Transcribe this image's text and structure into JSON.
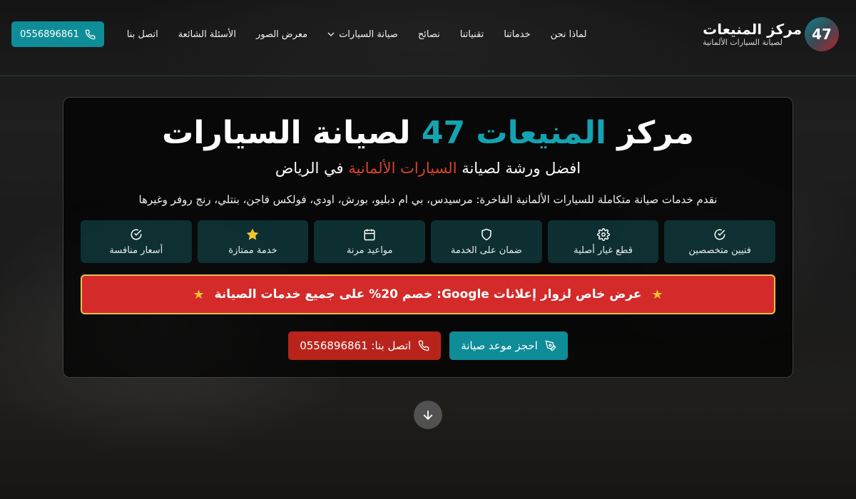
{
  "header": {
    "logo_text": "47",
    "brand_title": "مركز المنيعات",
    "brand_subtitle": "لصيانة السيارات الألمانية",
    "nav": [
      {
        "label": "لماذا نحن"
      },
      {
        "label": "خدماتنا"
      },
      {
        "label": "تقنياتنا"
      },
      {
        "label": "نصائح"
      },
      {
        "label": "صيانة السيارات",
        "has_dropdown": true
      },
      {
        "label": "معرض الصور"
      },
      {
        "label": "الأسئلة الشائعة"
      },
      {
        "label": "اتصل بنا"
      }
    ],
    "phone_button": "0556896861"
  },
  "hero": {
    "title_part1": "مركز ",
    "title_part2": "المنيعات 47",
    "title_part3": " لصيانة السيارات",
    "subtitle_part1": "افضل ورشة لصيانة ",
    "subtitle_part2": "السيارات الألمانية",
    "subtitle_part3": " في الرياض",
    "description": "نقدم خدمات صيانة متكاملة للسيارات الألمانية الفاخرة: مرسيدس، بي ام دبليو، بورش، اودي، فولكس فاجن، بنتلي، رنج روفر وغيرها",
    "features": [
      {
        "label": "فنيين متخصصين",
        "icon": "check-circle-icon"
      },
      {
        "label": "قطع غيار أصلية",
        "icon": "gear-icon"
      },
      {
        "label": "ضمان على الخدمة",
        "icon": "shield-icon"
      },
      {
        "label": "مواعيد مرنة",
        "icon": "calendar-icon"
      },
      {
        "label": "خدمة ممتازة",
        "icon": "star-icon"
      },
      {
        "label": "أسعار منافسة",
        "icon": "check-circle-icon"
      }
    ],
    "offer_text": "عرض خاص لزوار إعلانات Google: خصم 20% على جميع خدمات الصيانة",
    "book_button": "احجز موعد صيانة",
    "call_button": "اتصل بنا: 0556896861"
  },
  "colors": {
    "accent_teal": "#0e8d98",
    "accent_red": "#d42a2a",
    "offer_border": "#e6c04a"
  }
}
